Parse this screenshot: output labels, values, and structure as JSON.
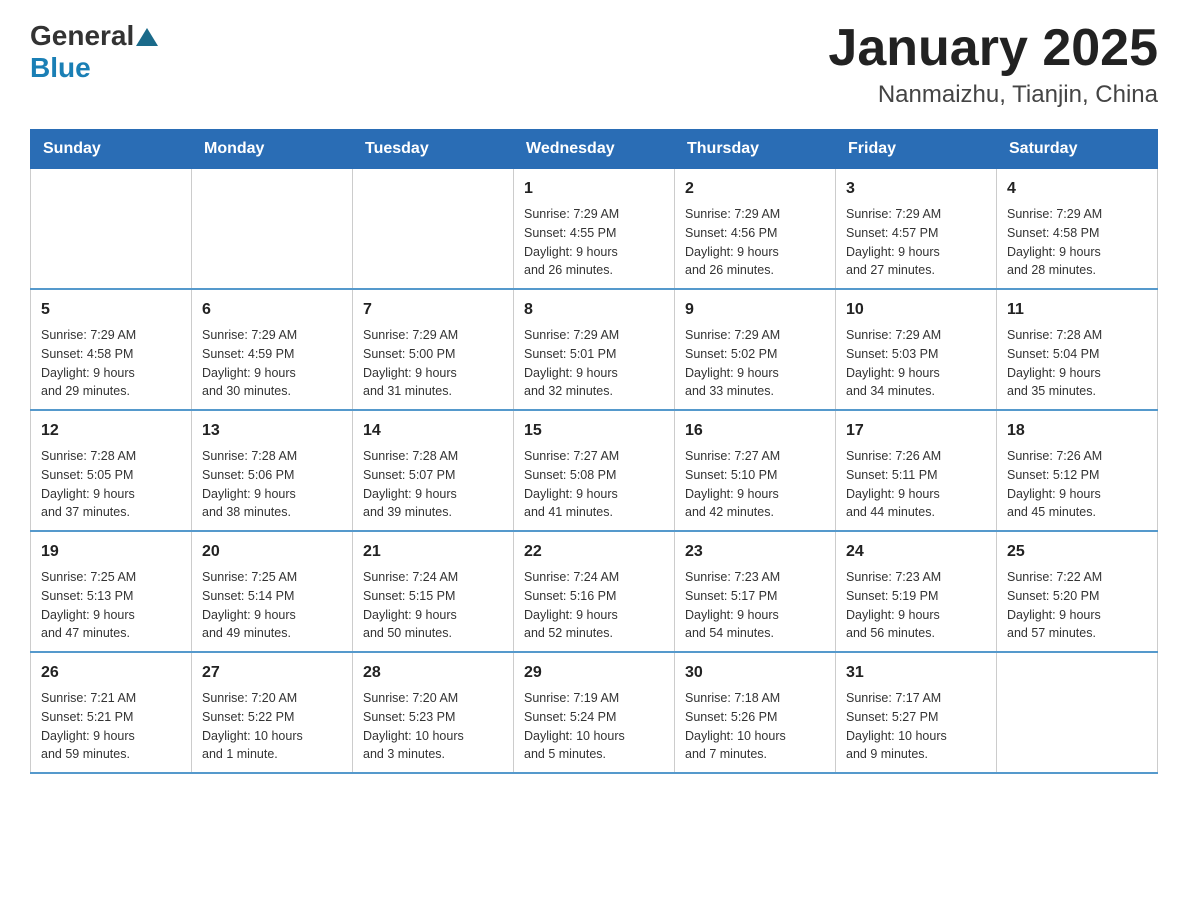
{
  "header": {
    "logo_general": "General",
    "logo_blue": "Blue",
    "title": "January 2025",
    "subtitle": "Nanmaizhu, Tianjin, China"
  },
  "calendar": {
    "weekdays": [
      "Sunday",
      "Monday",
      "Tuesday",
      "Wednesday",
      "Thursday",
      "Friday",
      "Saturday"
    ],
    "weeks": [
      [
        {
          "day": "",
          "info": ""
        },
        {
          "day": "",
          "info": ""
        },
        {
          "day": "",
          "info": ""
        },
        {
          "day": "1",
          "info": "Sunrise: 7:29 AM\nSunset: 4:55 PM\nDaylight: 9 hours\nand 26 minutes."
        },
        {
          "day": "2",
          "info": "Sunrise: 7:29 AM\nSunset: 4:56 PM\nDaylight: 9 hours\nand 26 minutes."
        },
        {
          "day": "3",
          "info": "Sunrise: 7:29 AM\nSunset: 4:57 PM\nDaylight: 9 hours\nand 27 minutes."
        },
        {
          "day": "4",
          "info": "Sunrise: 7:29 AM\nSunset: 4:58 PM\nDaylight: 9 hours\nand 28 minutes."
        }
      ],
      [
        {
          "day": "5",
          "info": "Sunrise: 7:29 AM\nSunset: 4:58 PM\nDaylight: 9 hours\nand 29 minutes."
        },
        {
          "day": "6",
          "info": "Sunrise: 7:29 AM\nSunset: 4:59 PM\nDaylight: 9 hours\nand 30 minutes."
        },
        {
          "day": "7",
          "info": "Sunrise: 7:29 AM\nSunset: 5:00 PM\nDaylight: 9 hours\nand 31 minutes."
        },
        {
          "day": "8",
          "info": "Sunrise: 7:29 AM\nSunset: 5:01 PM\nDaylight: 9 hours\nand 32 minutes."
        },
        {
          "day": "9",
          "info": "Sunrise: 7:29 AM\nSunset: 5:02 PM\nDaylight: 9 hours\nand 33 minutes."
        },
        {
          "day": "10",
          "info": "Sunrise: 7:29 AM\nSunset: 5:03 PM\nDaylight: 9 hours\nand 34 minutes."
        },
        {
          "day": "11",
          "info": "Sunrise: 7:28 AM\nSunset: 5:04 PM\nDaylight: 9 hours\nand 35 minutes."
        }
      ],
      [
        {
          "day": "12",
          "info": "Sunrise: 7:28 AM\nSunset: 5:05 PM\nDaylight: 9 hours\nand 37 minutes."
        },
        {
          "day": "13",
          "info": "Sunrise: 7:28 AM\nSunset: 5:06 PM\nDaylight: 9 hours\nand 38 minutes."
        },
        {
          "day": "14",
          "info": "Sunrise: 7:28 AM\nSunset: 5:07 PM\nDaylight: 9 hours\nand 39 minutes."
        },
        {
          "day": "15",
          "info": "Sunrise: 7:27 AM\nSunset: 5:08 PM\nDaylight: 9 hours\nand 41 minutes."
        },
        {
          "day": "16",
          "info": "Sunrise: 7:27 AM\nSunset: 5:10 PM\nDaylight: 9 hours\nand 42 minutes."
        },
        {
          "day": "17",
          "info": "Sunrise: 7:26 AM\nSunset: 5:11 PM\nDaylight: 9 hours\nand 44 minutes."
        },
        {
          "day": "18",
          "info": "Sunrise: 7:26 AM\nSunset: 5:12 PM\nDaylight: 9 hours\nand 45 minutes."
        }
      ],
      [
        {
          "day": "19",
          "info": "Sunrise: 7:25 AM\nSunset: 5:13 PM\nDaylight: 9 hours\nand 47 minutes."
        },
        {
          "day": "20",
          "info": "Sunrise: 7:25 AM\nSunset: 5:14 PM\nDaylight: 9 hours\nand 49 minutes."
        },
        {
          "day": "21",
          "info": "Sunrise: 7:24 AM\nSunset: 5:15 PM\nDaylight: 9 hours\nand 50 minutes."
        },
        {
          "day": "22",
          "info": "Sunrise: 7:24 AM\nSunset: 5:16 PM\nDaylight: 9 hours\nand 52 minutes."
        },
        {
          "day": "23",
          "info": "Sunrise: 7:23 AM\nSunset: 5:17 PM\nDaylight: 9 hours\nand 54 minutes."
        },
        {
          "day": "24",
          "info": "Sunrise: 7:23 AM\nSunset: 5:19 PM\nDaylight: 9 hours\nand 56 minutes."
        },
        {
          "day": "25",
          "info": "Sunrise: 7:22 AM\nSunset: 5:20 PM\nDaylight: 9 hours\nand 57 minutes."
        }
      ],
      [
        {
          "day": "26",
          "info": "Sunrise: 7:21 AM\nSunset: 5:21 PM\nDaylight: 9 hours\nand 59 minutes."
        },
        {
          "day": "27",
          "info": "Sunrise: 7:20 AM\nSunset: 5:22 PM\nDaylight: 10 hours\nand 1 minute."
        },
        {
          "day": "28",
          "info": "Sunrise: 7:20 AM\nSunset: 5:23 PM\nDaylight: 10 hours\nand 3 minutes."
        },
        {
          "day": "29",
          "info": "Sunrise: 7:19 AM\nSunset: 5:24 PM\nDaylight: 10 hours\nand 5 minutes."
        },
        {
          "day": "30",
          "info": "Sunrise: 7:18 AM\nSunset: 5:26 PM\nDaylight: 10 hours\nand 7 minutes."
        },
        {
          "day": "31",
          "info": "Sunrise: 7:17 AM\nSunset: 5:27 PM\nDaylight: 10 hours\nand 9 minutes."
        },
        {
          "day": "",
          "info": ""
        }
      ]
    ]
  }
}
